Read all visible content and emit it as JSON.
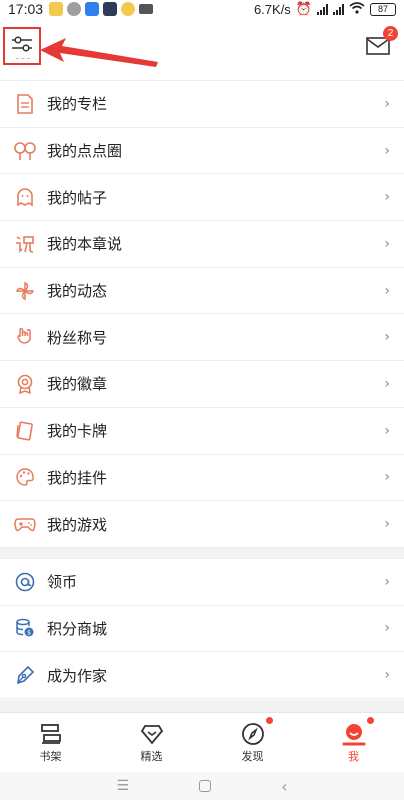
{
  "status_bar": {
    "time": "17:03",
    "speed": "6.7K/s",
    "battery": "87"
  },
  "header": {
    "mail_badge": "2"
  },
  "colors": {
    "accent": "#f44336",
    "icon_orange": "#e67c5f",
    "icon_blue": "#3b6fb6"
  },
  "menu_section_1": [
    {
      "label": "我的专栏",
      "icon": "document-icon"
    },
    {
      "label": "我的点点圈",
      "icon": "circles-icon"
    },
    {
      "label": "我的帖子",
      "icon": "ghost-icon"
    },
    {
      "label": "我的本章说",
      "icon": "speech-icon"
    },
    {
      "label": "我的动态",
      "icon": "pinwheel-icon"
    },
    {
      "label": "粉丝称号",
      "icon": "hand-icon"
    },
    {
      "label": "我的徽章",
      "icon": "medal-icon"
    },
    {
      "label": "我的卡牌",
      "icon": "card-icon"
    },
    {
      "label": "我的挂件",
      "icon": "palette-icon"
    },
    {
      "label": "我的游戏",
      "icon": "gamepad-icon"
    }
  ],
  "menu_section_2": [
    {
      "label": "领币",
      "icon": "at-coin-icon"
    },
    {
      "label": "积分商城",
      "icon": "coins-stack-icon"
    },
    {
      "label": "成为作家",
      "icon": "pen-icon"
    }
  ],
  "bottom_nav": [
    {
      "label": "书架",
      "icon": "bookshelf-icon",
      "dot": false,
      "active": false
    },
    {
      "label": "精选",
      "icon": "diamond-icon",
      "dot": false,
      "active": false
    },
    {
      "label": "发现",
      "icon": "compass-icon",
      "dot": true,
      "active": false
    },
    {
      "label": "我",
      "icon": "profile-icon",
      "dot": true,
      "active": true
    }
  ]
}
